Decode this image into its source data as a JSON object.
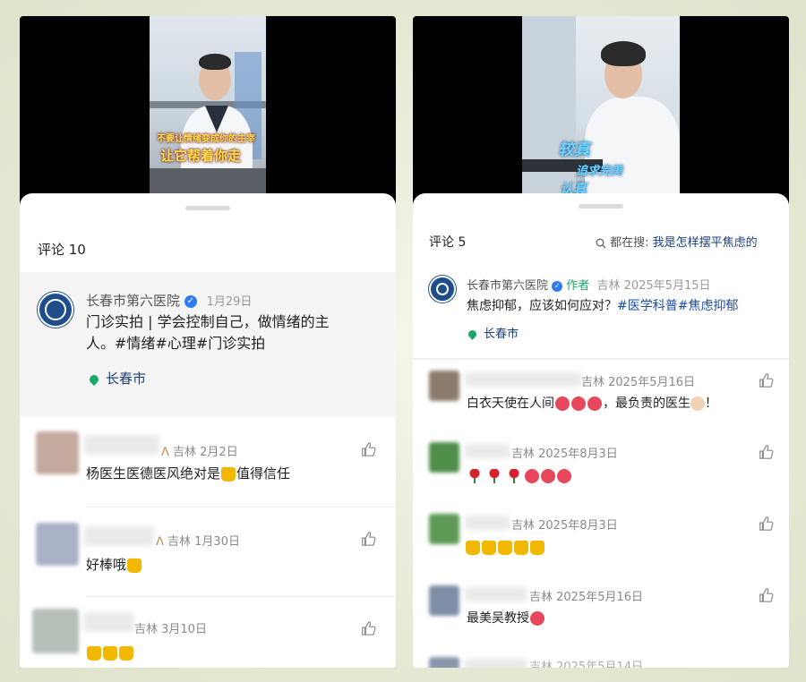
{
  "left": {
    "video_overlay_lines": [
      "不要让情绪变成你的主宰",
      "让它帮着你走"
    ],
    "comment_count": "评论 10",
    "post": {
      "author": "长春市第六医院",
      "date": "1月29日",
      "text_plain": "门诊实拍 | 学会控制自己，做情绪的主人。",
      "text_tags": "#情绪#心理#门诊实拍",
      "location": "长春市"
    },
    "comments": [
      {
        "meta": "吉林 2月2日",
        "text": "杨医生医德医风绝对是",
        "text_suffix": "值得信任"
      },
      {
        "meta": "吉林 1月30日",
        "text": "好棒哦"
      },
      {
        "meta": "吉林 3月10日",
        "text": ""
      }
    ]
  },
  "right": {
    "video_overlay_lines": [
      "较真",
      "追求完美",
      "认真"
    ],
    "comment_count": "评论 5",
    "search": {
      "prefix": "都在搜:",
      "query": "我是怎样摆平焦虑的"
    },
    "post": {
      "author": "长春市第六医院",
      "author_tag": "作者",
      "meta": "吉林  2025年5月15日",
      "text_plain": "焦虑抑郁，应该如何应对？",
      "text_tags": "#医学科普#焦虑抑郁",
      "location": "长春市"
    },
    "comments": [
      {
        "meta": "吉林  2025年5月16日",
        "text_prefix": "白衣天使在人间",
        "text_suffix": "，最负责的医生",
        "text_end": "！"
      },
      {
        "meta": "吉林  2025年8月3日"
      },
      {
        "meta": "吉林  2025年8月3日"
      },
      {
        "meta": "吉林  2025年5月16日",
        "text": "最美吴教授"
      },
      {
        "meta": "吉林  2025年5月14日"
      }
    ]
  },
  "colors": {
    "tag": "#1a4ea8",
    "verified": "#2f7cf6",
    "location": "#1aa86a",
    "logo": "#1e4d8c"
  },
  "icons": [
    "verified-badge-icon",
    "location-pin-icon",
    "like-thumb-icon",
    "search-icon",
    "heart-emoji",
    "thumbs-up-emoji",
    "rose-emoji"
  ]
}
